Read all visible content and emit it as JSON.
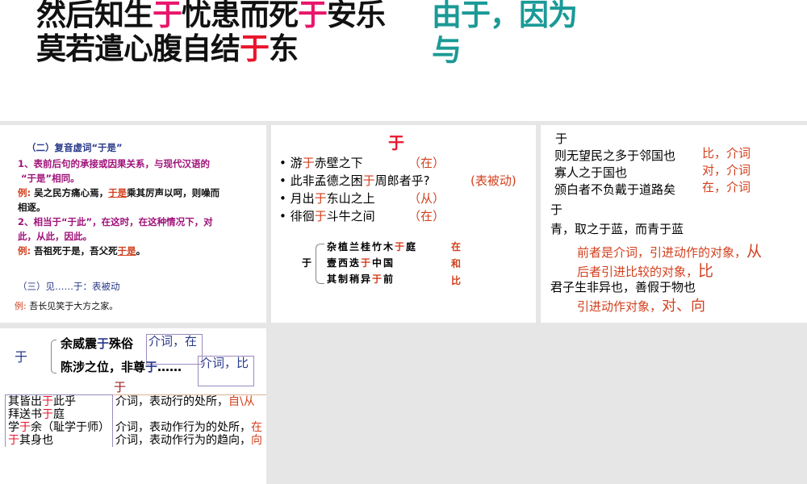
{
  "top": {
    "line1": [
      "然后知生",
      "于",
      "忧患而死",
      "于",
      "安乐"
    ],
    "line2": [
      "莫若遣心腹自结",
      "于",
      "东"
    ],
    "teal1": "由于，因为",
    "teal2": "与"
  },
  "panel1": {
    "heading": "（二）复音虚词“于是”",
    "item1": "1、表前后句的承接或因果关系，与现代汉语的",
    "item1b": "“于是”相同。",
    "ex_label": "例:",
    "ex1a": "吴之民方痛心焉，",
    "ex1u": "于是",
    "ex1b": "乘其厉声以呵，则噪而",
    "ex1c": "相逐。",
    "item2": "2、相当于“于此”，在这时，在这种情况下，对",
    "item2b": "此，从此，因此。",
    "ex2a": "吾祖死于是，吾父死",
    "ex2u": "于是",
    "ex2b": "。",
    "heading3": "（三）见……于：表被动",
    "ex3": "吾长见笑于大方之家。"
  },
  "panel2": {
    "title": "于",
    "bullets": [
      {
        "pre": "游",
        "yu": "于",
        "post": "赤壁之下",
        "note": "（在）"
      },
      {
        "pre": "此非孟德之困",
        "yu": "于",
        "post": "周郎者乎?",
        "note": "(表被动)"
      },
      {
        "pre": "月出",
        "yu": "于",
        "post": "东山之上",
        "note": "（从）"
      },
      {
        "pre": "徘徊",
        "yu": "于",
        "post": "斗牛之间",
        "note": "（在）"
      }
    ],
    "brace_label": "于",
    "sub": [
      {
        "pre": "杂植兰桂竹木",
        "yu": "于",
        "post": "庭",
        "note": "在"
      },
      {
        "pre": "壹西迭",
        "yu": "于",
        "post": "中国",
        "note": "和"
      },
      {
        "pre": "其制稍异",
        "yu": "于",
        "post": "前",
        "note": "比"
      }
    ]
  },
  "panel3": {
    "h1": "于",
    "rows": [
      {
        "text": "则无望民之多于邻国也",
        "note": "比，介词"
      },
      {
        "text": "寡人之于国也",
        "note": "对，介词"
      },
      {
        "text": "颁白者不负戴于道路矣",
        "note": "在，介词"
      }
    ],
    "h2": "于",
    "s1": "青，取之于蓝，而青于蓝",
    "n1": "前者是介词，引进动作的对象，",
    "n1b": "从",
    "n2": "后者引进比较的对象，",
    "n2b": "比",
    "s2": "君子生非异也，善假于物也",
    "n3": "引进动作对象，",
    "n3b": "对、向"
  },
  "panel4": {
    "label": "于",
    "r1a": "余威震",
    "r1y": "于",
    "r1b": "殊俗",
    "box1": "介词，在",
    "r2a": "陈涉之位，非尊",
    "r2y": "于",
    "r2b": "……",
    "box2": "介词，比",
    "center": "于",
    "table": [
      {
        "a": [
          "其皆出",
          "于",
          "此乎"
        ],
        "b": "介词，表动行的处所，",
        "c": "自\\从"
      },
      {
        "a": [
          "拜送书",
          "于",
          "庭"
        ],
        "b": "",
        "c": ""
      },
      {
        "a": [
          "学",
          "于",
          "余（耻学于师）"
        ],
        "b": "介词，表动作行为的处所，",
        "c": "在"
      },
      {
        "a": [
          "",
          "于",
          "其身也"
        ],
        "b": "介词，表动作行为的趋向，",
        "c": "向"
      }
    ]
  }
}
